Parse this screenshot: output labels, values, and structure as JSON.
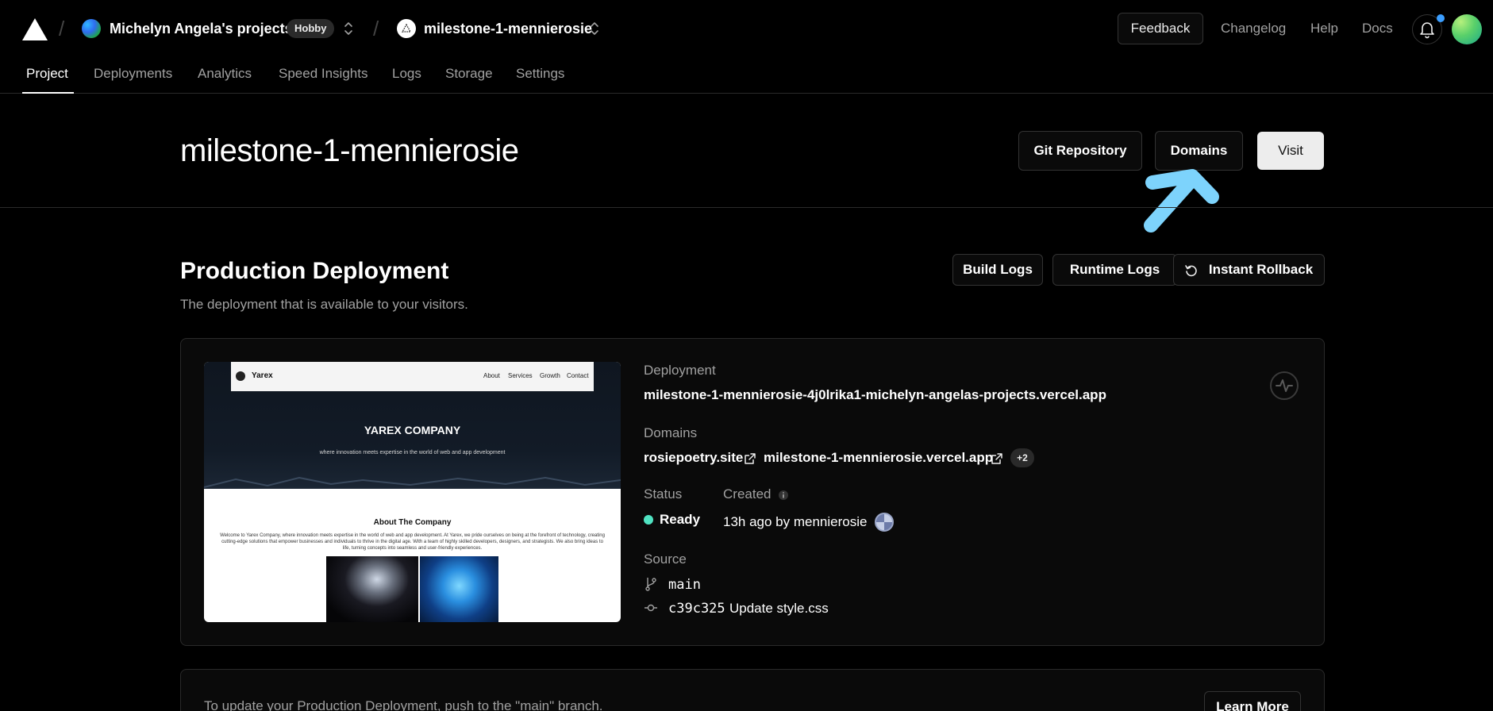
{
  "topbar": {
    "team_name": "Michelyn Angela's projects",
    "plan_badge": "Hobby",
    "project_name": "milestone-1-mennierosie",
    "feedback_label": "Feedback",
    "links": [
      "Changelog",
      "Help",
      "Docs"
    ]
  },
  "tabs": [
    "Project",
    "Deployments",
    "Analytics",
    "Speed Insights",
    "Logs",
    "Storage",
    "Settings"
  ],
  "active_tab": "Project",
  "header": {
    "title": "milestone-1-mennierosie",
    "git_repository_label": "Git Repository",
    "domains_label": "Domains",
    "visit_label": "Visit"
  },
  "production": {
    "title": "Production Deployment",
    "subtitle": "The deployment that is available to your visitors.",
    "build_logs_label": "Build Logs",
    "runtime_logs_label": "Runtime Logs",
    "instant_rollback_label": "Instant Rollback"
  },
  "preview": {
    "brand": "Yarex",
    "nav_links": [
      "About",
      "Services",
      "Growth",
      "Contact"
    ],
    "hero_title": "YAREX COMPANY",
    "hero_tagline": "where innovation meets expertise in the world of web and app development",
    "about_title": "About The Company",
    "about_body": "Welcome to Yarex Company, where innovation meets expertise in the world of web and app development. At Yarex, we pride ourselves on being at the forefront of technology, creating cutting-edge solutions that empower businesses and individuals to thrive in the digital age. With a team of highly skilled developers, designers, and strategists. We also bring ideas to life, turning concepts into seamless and user-friendly experiences."
  },
  "deployment": {
    "deployment_label": "Deployment",
    "deployment_url": "milestone-1-mennierosie-4j0lrika1-michelyn-angelas-projects.vercel.app",
    "domains_label": "Domains",
    "domain_1": "rosiepoetry.site",
    "domain_2": "milestone-1-mennierosie.vercel.app",
    "more_domains": "+2",
    "status_label": "Status",
    "status_value": "Ready",
    "status_color": "#50e3c2",
    "created_label": "Created",
    "created_value": "13h ago by mennierosie",
    "source_label": "Source",
    "branch": "main",
    "commit_hash": "c39c325",
    "commit_message": "Update style.css"
  },
  "note": {
    "text": "To update your Production Deployment, push to the \"main\" branch.",
    "learn_more_label": "Learn More"
  },
  "colors": {
    "background": "#000000",
    "accent_pointer": "#7dd3fc",
    "notification_dot": "#3b9eff"
  }
}
